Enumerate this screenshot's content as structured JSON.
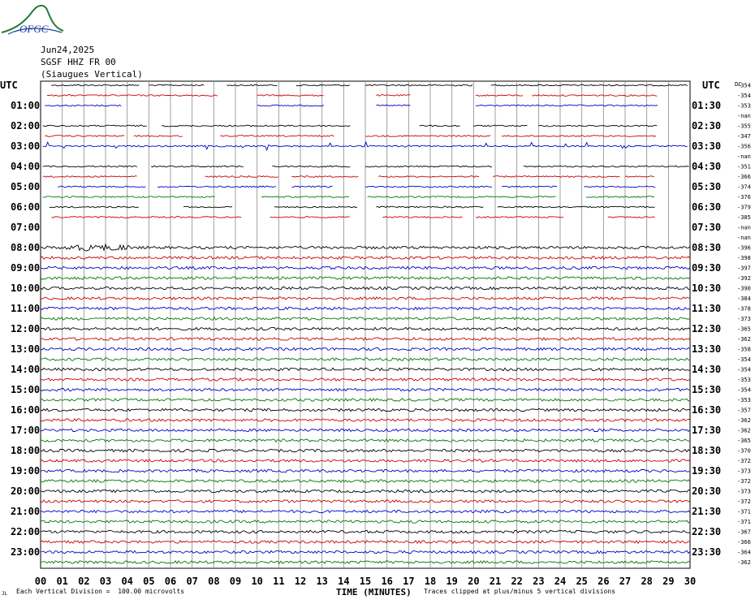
{
  "header": {
    "date": "Jun24,2025",
    "station": "SGSF HHZ FR 00",
    "description": "(Siaugues Vertical)"
  },
  "logo": {
    "text": "OFGC",
    "color": "#2a7a3a",
    "text_color": "#1a3fa0"
  },
  "footer": {
    "scale_note": "Each Vertical Division =  100.00 microvolts",
    "xlabel": "TIME (MINUTES)",
    "clip_note": "Traces clipped at plus/minus 5 vertical divisions",
    "mark": "JL"
  },
  "chart_data": {
    "type": "line",
    "title": "SGSF HHZ FR 00 (Siaugues Vertical)",
    "xlabel": "TIME (MINUTES)",
    "ylabel_left": "UTC",
    "ylabel_right": "UTC",
    "rms_header": "DC",
    "xlim": [
      0,
      30
    ],
    "x_ticks": [
      "00",
      "01",
      "02",
      "03",
      "04",
      "05",
      "06",
      "07",
      "08",
      "09",
      "10",
      "11",
      "12",
      "13",
      "14",
      "15",
      "16",
      "17",
      "18",
      "19",
      "20",
      "21",
      "22",
      "23",
      "24",
      "25",
      "26",
      "27",
      "28",
      "29",
      "30"
    ],
    "grid": true,
    "trace_colors": [
      "#000000",
      "#cc0000",
      "#0000cc",
      "#007700"
    ],
    "left_labels": [
      "UTC",
      "",
      "01:00",
      "",
      "02:00",
      "",
      "03:00",
      "",
      "04:00",
      "",
      "05:00",
      "",
      "06:00",
      "",
      "07:00",
      "",
      "08:00",
      "",
      "09:00",
      "",
      "10:00",
      "",
      "11:00",
      "",
      "12:00",
      "",
      "13:00",
      "",
      "14:00",
      "",
      "15:00",
      "",
      "16:00",
      "",
      "17:00",
      "",
      "18:00",
      "",
      "19:00",
      "",
      "20:00",
      "",
      "21:00",
      "",
      "22:00",
      "",
      "23:00",
      ""
    ],
    "right_labels": [
      "UTC",
      "",
      "01:30",
      "",
      "02:30",
      "",
      "03:30",
      "",
      "04:30",
      "",
      "05:30",
      "",
      "06:30",
      "",
      "07:30",
      "",
      "08:30",
      "",
      "09:30",
      "",
      "10:30",
      "",
      "11:30",
      "",
      "12:30",
      "",
      "13:30",
      "",
      "14:30",
      "",
      "15:30",
      "",
      "16:30",
      "",
      "17:30",
      "",
      "18:30",
      "",
      "19:30",
      "",
      "20:30",
      "",
      "21:30",
      "",
      "22:30",
      "",
      "23:30",
      ""
    ],
    "dc_offsets": [
      "-354",
      "-354",
      "-353",
      "-nan",
      "-355",
      "-347",
      "-356",
      "-nan",
      "-351",
      "-366",
      "-374",
      "-376",
      "-379",
      "-385",
      "-nan",
      "-nan",
      "-396",
      "-398",
      "-397",
      "-392",
      "-390",
      "-384",
      "-378",
      "-373",
      "-365",
      "-362",
      "-358",
      "-354",
      "-354",
      "-353",
      "-354",
      "-353",
      "-357",
      "-362",
      "-362",
      "-365",
      "-370",
      "-372",
      "-373",
      "-372",
      "-373",
      "-372",
      "-371",
      "-371",
      "-367",
      "-366",
      "-364",
      "-362"
    ],
    "gaps_note": "rows 0-13 partial data with gaps; rows 14-15 no data",
    "segments": [
      [
        [
          0.5,
          4.6
        ],
        [
          5.0,
          7.6
        ],
        [
          8.6,
          11.0
        ],
        [
          11.8,
          14.3
        ],
        [
          15.0,
          20.0
        ],
        [
          20.8,
          29.9
        ]
      ],
      [
        [
          0.3,
          8.2
        ],
        [
          10.0,
          13.1
        ],
        [
          15.5,
          17.1
        ],
        [
          20.1,
          22.3
        ],
        [
          22.7,
          28.5
        ]
      ],
      [
        [
          0.2,
          3.8
        ],
        [
          10.0,
          13.1
        ],
        [
          15.5,
          17.1
        ],
        [
          20.1,
          28.5
        ]
      ],
      [],
      [
        [
          0.1,
          4.9
        ],
        [
          5.6,
          14.3
        ],
        [
          17.5,
          19.4
        ],
        [
          20.0,
          22.5
        ],
        [
          23.0,
          28.5
        ]
      ],
      [
        [
          0.2,
          3.9
        ],
        [
          4.3,
          6.6
        ],
        [
          8.3,
          13.6
        ],
        [
          15.0,
          20.8
        ],
        [
          21.3,
          28.5
        ]
      ],
      [
        [
          0.1,
          29.9
        ]
      ],
      [],
      [
        [
          0.1,
          4.5
        ],
        [
          5.1,
          9.4
        ],
        [
          10.7,
          14.3
        ],
        [
          15.0,
          20.9
        ],
        [
          22.3,
          30.0
        ]
      ],
      [
        [
          0.1,
          4.5
        ],
        [
          7.6,
          11.0
        ],
        [
          11.6,
          14.7
        ],
        [
          15.6,
          20.3
        ],
        [
          20.9,
          26.8
        ],
        [
          27.0,
          28.4
        ]
      ],
      [
        [
          0.8,
          4.9
        ],
        [
          5.4,
          10.9
        ],
        [
          11.6,
          13.5
        ],
        [
          15.0,
          20.9
        ],
        [
          21.3,
          23.9
        ],
        [
          25.1,
          28.4
        ]
      ],
      [
        [
          0.1,
          8.1
        ],
        [
          10.2,
          14.3
        ],
        [
          15.1,
          23.8
        ],
        [
          25.2,
          28.4
        ]
      ],
      [
        [
          0.4,
          4.6
        ],
        [
          6.6,
          8.9
        ],
        [
          10.8,
          14.7
        ],
        [
          15.5,
          20.5
        ],
        [
          21.1,
          28.4
        ]
      ],
      [
        [
          0.5,
          9.3
        ],
        [
          10.6,
          14.3
        ],
        [
          15.8,
          19.5
        ],
        [
          20.1,
          24.2
        ],
        [
          26.2,
          28.4
        ]
      ],
      [],
      []
    ]
  }
}
